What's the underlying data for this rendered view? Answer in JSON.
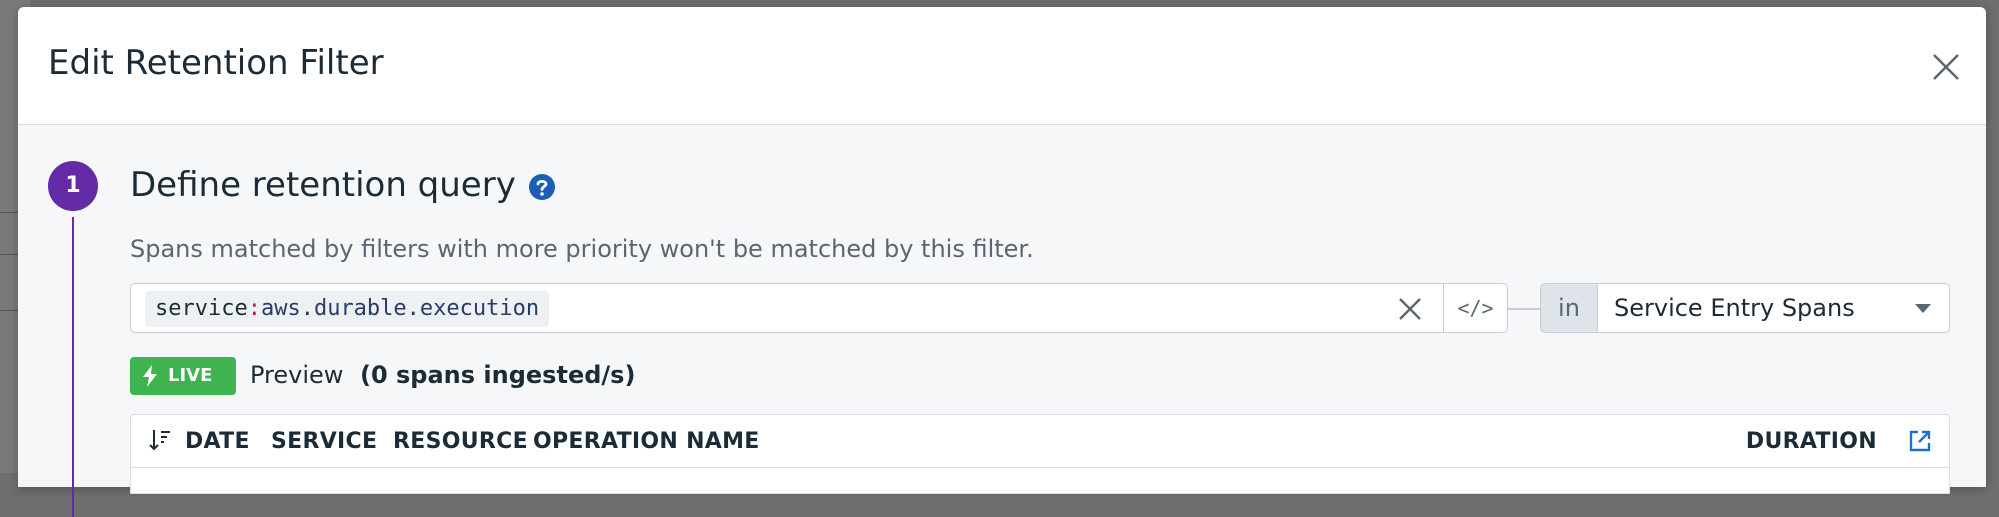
{
  "modal": {
    "title": "Edit Retention Filter"
  },
  "step": {
    "number": "1",
    "title": "Define retention query",
    "description": "Spans matched by filters with more priority won't be matched by this filter."
  },
  "query": {
    "key": "service",
    "separator": ":",
    "value": "aws.durable.execution",
    "code_toggle_label": "</>"
  },
  "scope": {
    "in_label": "in",
    "selected": "Service Entry Spans"
  },
  "live": {
    "badge": "LIVE",
    "preview_label": "Preview",
    "rate": "(0 spans ingested/s)"
  },
  "table": {
    "columns": [
      "DATE",
      "SERVICE",
      "RESOURCE",
      "OPERATION NAME",
      "DURATION"
    ]
  },
  "colors": {
    "accent_purple": "#632ca6",
    "live_green": "#3fb34f",
    "link_blue": "#1a73c9"
  },
  "icons": [
    "close-icon",
    "help-icon",
    "clear-icon",
    "code-icon",
    "chevron-down-icon",
    "lightning-icon",
    "sort-icon",
    "open-external-icon"
  ]
}
